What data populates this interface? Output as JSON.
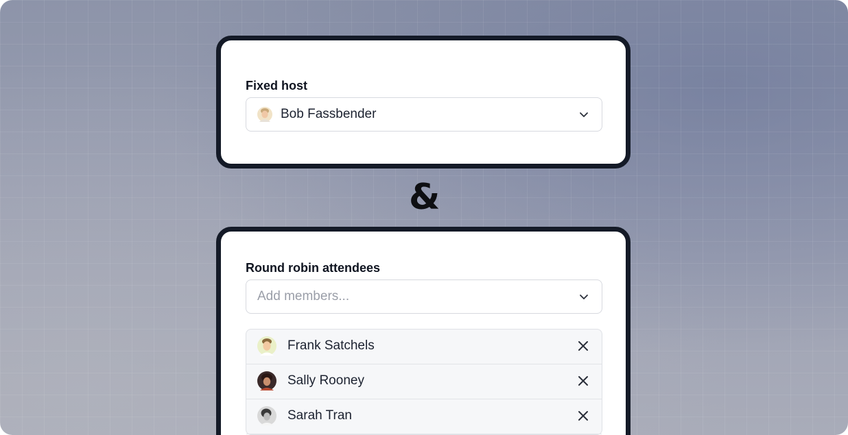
{
  "fixed_host": {
    "label": "Fixed host",
    "selected_value": "Bob Fassbender"
  },
  "separator": "&",
  "round_robin": {
    "label": "Round robin attendees",
    "placeholder": "Add members...",
    "attendees": [
      {
        "name": "Frank Satchels",
        "avatar": "avatar-frank"
      },
      {
        "name": "Sally Rooney",
        "avatar": "avatar-sally"
      },
      {
        "name": "Sarah Tran",
        "avatar": "avatar-sarah"
      }
    ]
  },
  "icons": {
    "dropdown": "chevron-down-icon",
    "remove": "close-icon"
  },
  "colors": {
    "card_border": "#141a27",
    "text_primary": "#0f1420",
    "placeholder": "#9a9ea8"
  }
}
